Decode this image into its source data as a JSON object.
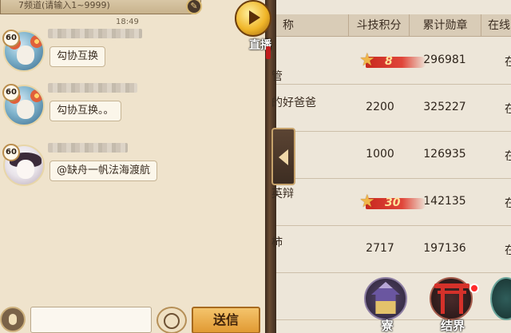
{
  "chat": {
    "channel_text": "7频道(请输入1~9999)",
    "timestamp": "18:49",
    "messages": [
      {
        "level": "60",
        "text": "勾协互换"
      },
      {
        "level": "60",
        "text": "勾协互换。。"
      },
      {
        "level": "60",
        "text": "@缺舟一帆法海渡航"
      }
    ],
    "send_label": "送信"
  },
  "live": {
    "label": "直播"
  },
  "ranking": {
    "columns": {
      "name": "称",
      "score": "斗技积分",
      "medals": "累计勋章",
      "online": "在线"
    },
    "rows": [
      {
        "name": "管",
        "score": "",
        "star_rank": "8",
        "medals": "296981",
        "online": "在"
      },
      {
        "name": "的好爸爸",
        "score": "2200",
        "star_rank": "",
        "medals": "325227",
        "online": "在"
      },
      {
        "name": "",
        "score": "1000",
        "star_rank": "",
        "medals": "126935",
        "online": "在"
      },
      {
        "name": "英辩",
        "score": "",
        "star_rank": "30",
        "medals": "142135",
        "online": "在"
      },
      {
        "name": "柿",
        "score": "2717",
        "star_rank": "",
        "medals": "197136",
        "online": "在"
      },
      {
        "name": "",
        "score": "",
        "star_rank": "",
        "medals": "",
        "online": ""
      }
    ]
  },
  "bottom_nav": [
    {
      "label": "寮",
      "icon": "temple-icon"
    },
    {
      "label": "结界",
      "icon": "torii-gate-icon",
      "has_notification": true
    },
    {
      "label": "",
      "icon": "partial-icon"
    }
  ]
}
